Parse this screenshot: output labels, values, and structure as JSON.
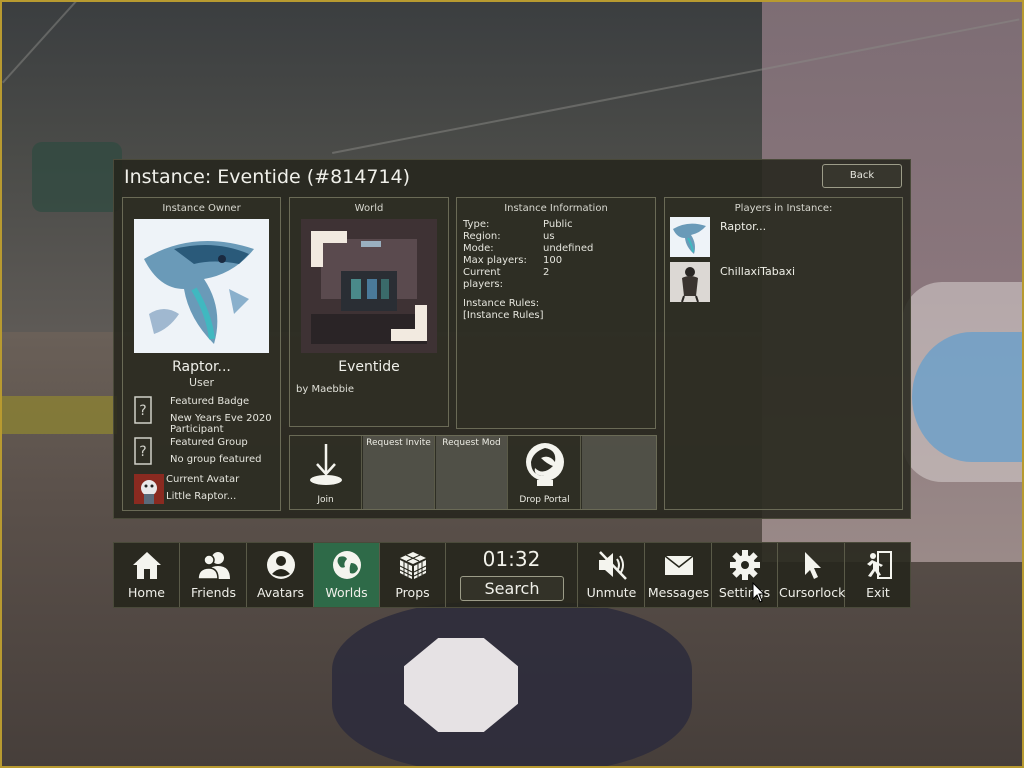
{
  "instance_panel": {
    "title": "Instance: Eventide (#814714)",
    "back_label": "Back",
    "owner": {
      "header": "Instance Owner",
      "name": "Raptor...",
      "role": "User",
      "featured_badge_label": "Featured Badge",
      "featured_badge_value": "New Years Eve 2020 Participant",
      "featured_group_label": "Featured Group",
      "featured_group_value": "No group featured",
      "current_avatar_label": "Current Avatar",
      "current_avatar_value": "Little Raptor..."
    },
    "world": {
      "header": "World",
      "name": "Eventide",
      "author": "by Maebbie"
    },
    "info": {
      "header": "Instance Information",
      "rows": [
        {
          "key": "Type:",
          "value": "Public"
        },
        {
          "key": "Region:",
          "value": "us"
        },
        {
          "key": "Mode:",
          "value": "undefined"
        },
        {
          "key": "Max players:",
          "value": "100"
        },
        {
          "key": "Current players:",
          "value": "2"
        }
      ],
      "rules_label": "Instance Rules:",
      "rules_value": "[Instance Rules]"
    },
    "players": {
      "header": "Players in Instance:",
      "list": [
        {
          "name": "Raptor..."
        },
        {
          "name": "ChillaxiTabaxi"
        }
      ]
    },
    "actions": {
      "join": "Join",
      "request_invite": "Request Invite",
      "request_mod": "Request Mod",
      "drop_portal": "Drop Portal"
    }
  },
  "menu": {
    "home": "Home",
    "friends": "Friends",
    "avatars": "Avatars",
    "worlds": "Worlds",
    "props": "Props",
    "time": "01:32",
    "search": "Search",
    "unmute": "Unmute",
    "messages": "Messages",
    "settings": "Settings",
    "cursorlock": "Cursorlock",
    "exit": "Exit",
    "active_item": "Worlds"
  },
  "colors": {
    "panel_bg": "#26261c",
    "active_tab": "#2e6a48",
    "frame_border": "#b89a30"
  }
}
